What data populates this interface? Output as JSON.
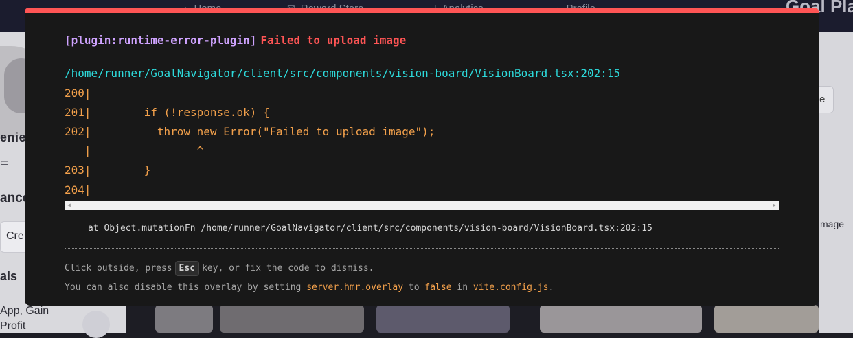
{
  "background": {
    "nav": [
      "Home",
      "Reward Store",
      "Analytics",
      "Profile"
    ],
    "nav_icons": [
      "home-icon",
      "gift-icon",
      "chart-icon",
      "user-icon"
    ],
    "brand": "Goal Pla",
    "sidebar": {
      "username": "enie.",
      "balance_label": "ance",
      "create_button": "Cre",
      "goals_label": "als",
      "goal_text_1": "App, Gain",
      "goal_text_2": "Profit"
    },
    "right": {
      "button_label": "e",
      "label": "mage"
    }
  },
  "overlay": {
    "plugin": "[plugin:runtime-error-plugin]",
    "message": "Failed to upload image",
    "file": "/home/runner/GoalNavigator/client/src/components/vision-board/VisionBoard.tsx:202:15",
    "code_lines": [
      "200|",
      "201|        if (!response.ok) {",
      "202|          throw new Error(\"Failed to upload image\");",
      "   |                ^",
      "203|        }",
      "204|"
    ],
    "stack_prefix": "at Object.mutationFn",
    "stack_file": "/home/runner/GoalNavigator/client/src/components/vision-board/VisionBoard.tsx:202:15",
    "tip1_before": "Click outside, press",
    "tip1_key": "Esc",
    "tip1_after": "key, or fix the code to dismiss.",
    "tip2_before": "You can also disable this overlay by setting",
    "tip2_setting": "server.hmr.overlay",
    "tip2_mid": "to",
    "tip2_value": "false",
    "tip2_in": "in",
    "tip2_file": "vite.config.js",
    "tip2_end": "."
  },
  "colors": {
    "accent": "#ff5555",
    "plugin": "#cfa3ff",
    "link": "#2dd9da",
    "code": "#f2a04b",
    "overlay_bg": "#181818"
  }
}
